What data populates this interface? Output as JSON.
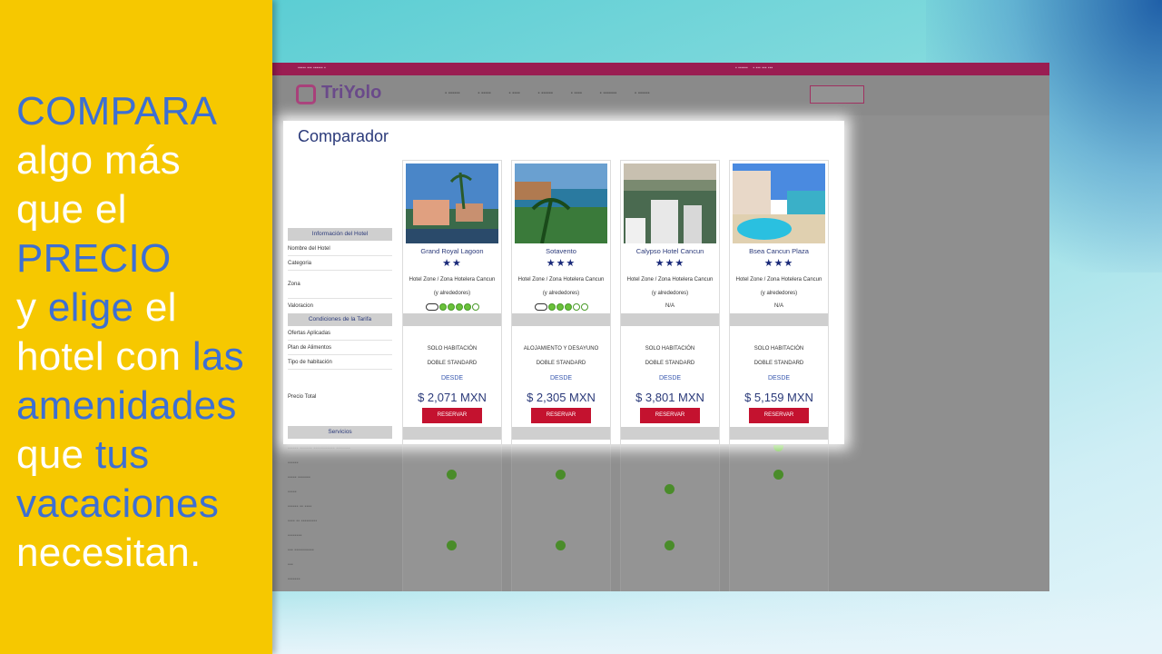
{
  "slogan": {
    "lines": [
      {
        "text": "COMPARA",
        "color": "blue"
      },
      {
        "text": "algo más",
        "color": "white"
      },
      {
        "text": "que el",
        "color": "white"
      },
      {
        "text": "PRECIO",
        "color": "blue"
      },
      {
        "text": "y elige el",
        "color": "mixed"
      },
      {
        "text": "hotel con las",
        "color": "mixed"
      },
      {
        "text": "amenidades",
        "color": "blue"
      },
      {
        "text": "que tus",
        "color": "mixed"
      },
      {
        "text": "vacaciones",
        "color": "blue"
      },
      {
        "text": "necesitan.",
        "color": "white"
      }
    ],
    "colors": {
      "white": "#ffffff",
      "blue": "#3d6fd3",
      "panel": "#f6c800"
    }
  },
  "site": {
    "logo": "TriYolo",
    "brand_color": "#9a1d52",
    "title": "Comparador",
    "row_labels": {
      "info_header": "Información del Hotel",
      "name": "Nombre del Hotel",
      "category": "Categoria",
      "zone": "Zona",
      "rating": "Valoracion",
      "tariff_header": "Condiciones de la Tarifa",
      "offers": "Ofertas Aplicadas",
      "meal_plan": "Plan de Alimentos",
      "room_type": "Tipo de habitación",
      "total_price": "Precio Total",
      "services_header": "Servicios"
    },
    "hotels": [
      {
        "name": "Grand Royal Lagoon",
        "stars": "★★",
        "zone": "Hotel Zone / Zona Hotelera Cancun (y alrededores)",
        "rating": "tripadvisor",
        "rating_score": 4,
        "meal": "SOLO HABITACIÓN",
        "room": "DOBLE STANDARD",
        "desde": "DESDE",
        "price": "$ 2,071 MXN",
        "button": "RESERVAR"
      },
      {
        "name": "Sotavento",
        "stars": "★★★",
        "zone": "Hotel Zone / Zona Hotelera Cancun (y alrededores)",
        "rating": "tripadvisor",
        "rating_score": 3,
        "meal": "ALOJAMIENTO Y DESAYUNO",
        "room": "DOBLE STANDARD",
        "desde": "DESDE",
        "price": "$ 2,305 MXN",
        "button": "RESERVAR"
      },
      {
        "name": "Calypso Hotel Cancun",
        "stars": "★★★",
        "zone": "Hotel Zone / Zona Hotelera Cancun (y alrededores)",
        "rating": "N/A",
        "rating_score": 0,
        "meal": "SOLO HABITACIÓN",
        "room": "DOBLE STANDARD",
        "desde": "DESDE",
        "price": "$ 3,801 MXN",
        "button": "RESERVAR"
      },
      {
        "name": "Bsea Cancun Plaza",
        "stars": "★★★",
        "zone": "Hotel Zone / Zona Hotelera Cancun (y alrededores)",
        "rating": "N/A",
        "rating_score": 0,
        "meal": "SOLO HABITACIÓN",
        "room": "DOBLE STANDARD",
        "desde": "DESDE",
        "price": "$ 5,159 MXN",
        "button": "RESERVAR"
      }
    ]
  }
}
